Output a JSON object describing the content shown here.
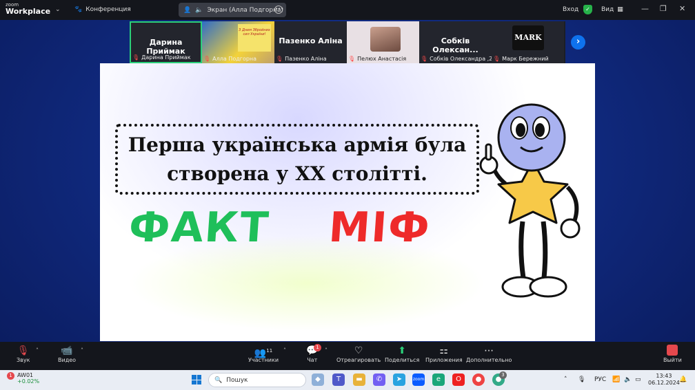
{
  "titlebar": {
    "logo_small": "zoom",
    "logo_big": "Workplace",
    "menu_label": "Конференция",
    "share_label": "Экран (Алла Подгорна)",
    "signin_label": "Вход",
    "view_label": "Вид",
    "minimize": "—",
    "restore": "❐",
    "close": "✕"
  },
  "participants": [
    {
      "display": "Дарина Приймак",
      "caption": "Дарина Приймак",
      "active": true
    },
    {
      "display": "",
      "caption": "Алла Подгорна",
      "poster": "З Днем Збройних сил України!"
    },
    {
      "display": "Пазенко Аліна",
      "caption": "Пазенко Аліна"
    },
    {
      "display": "",
      "caption": "Пелюх Анастасія"
    },
    {
      "display": "Собків Олексан...",
      "caption": "Собків Олександра ,2..."
    },
    {
      "display": "MARK",
      "caption": "Марк Бережний"
    }
  ],
  "slide": {
    "statement_line1": "Перша українська армія була",
    "statement_line2": "створена у ХХ столітті.",
    "fact_label": "ФАКТ",
    "myth_label": "МІФ",
    "fact_color": "#1fbf5a",
    "myth_color": "#ee2a2a"
  },
  "controls": {
    "audio_label": "Звук",
    "video_label": "Видео",
    "participants_label": "Участники",
    "participants_count": "11",
    "chat_label": "Чат",
    "chat_badge": "1",
    "react_label": "Отреагировать",
    "share_label": "Поделиться",
    "apps_label": "Приложения",
    "more_label": "Дополнительно",
    "leave_label": "Выйти"
  },
  "taskbar": {
    "stock_badge": "1",
    "stock_name": "AW01",
    "stock_change": "+0.02%",
    "search_placeholder": "Пошук",
    "language": "РУС",
    "time": "13:43",
    "date": "06.12.2024",
    "chrome_badge": "3"
  }
}
